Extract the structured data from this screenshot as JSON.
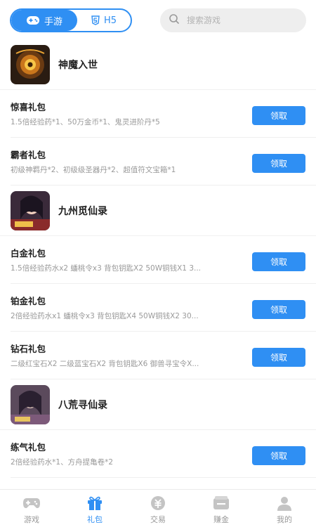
{
  "header": {
    "tabs": [
      {
        "label": "手游",
        "active": true
      },
      {
        "label": "H5",
        "active": false
      }
    ],
    "search": {
      "placeholder": "搜索游戏"
    }
  },
  "games": [
    {
      "name": "神魔入世",
      "icon": "game-art-icon",
      "gifts": [
        {
          "title": "惊喜礼包",
          "desc": "1.5倍经验药*1、50万金币*1、鬼灵进阶丹*5",
          "button": "领取"
        },
        {
          "title": "霸者礼包",
          "desc": "初级神羁丹*2、初级级圣器丹*2、超值符文宝箱*1",
          "button": "领取"
        }
      ]
    },
    {
      "name": "九州觅仙录",
      "icon": "game-art-icon",
      "gifts": [
        {
          "title": "白金礼包",
          "desc": "1.5倍经验药水x2 蟠桃令x3 背包钥匙X2 50W铜钱X1 3...",
          "button": "领取"
        },
        {
          "title": "铂金礼包",
          "desc": "2倍经验药水x1 蟠桃令x3 背包钥匙X4 50W铜钱X2 30...",
          "button": "领取"
        },
        {
          "title": "钻石礼包",
          "desc": "二级红宝石X2 二级蓝宝石X2 背包钥匙X6 御兽寻宝令X...",
          "button": "领取"
        }
      ]
    },
    {
      "name": "八荒寻仙录",
      "icon": "game-art-icon",
      "gifts": [
        {
          "title": "练气礼包",
          "desc": "2倍经验药水*1、方舟提亀卷*2",
          "button": "领取"
        }
      ]
    }
  ],
  "nav": [
    {
      "label": "游戏",
      "icon": "gamepad-icon",
      "active": false
    },
    {
      "label": "礼包",
      "icon": "gift-icon",
      "active": true
    },
    {
      "label": "交易",
      "icon": "trade-icon",
      "active": false
    },
    {
      "label": "赚金",
      "icon": "wallet-icon",
      "active": false
    },
    {
      "label": "我的",
      "icon": "user-icon",
      "active": false
    }
  ],
  "colors": {
    "accent": "#2f8ff3",
    "muted": "#9a9a9a",
    "nav_inactive": "#bdbdbd"
  }
}
